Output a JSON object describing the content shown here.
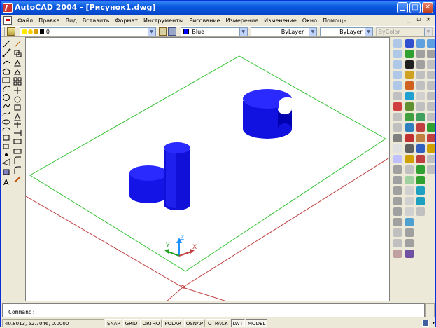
{
  "window": {
    "title": "AutoCAD 2004 - [Рисунок1.dwg]"
  },
  "menu": [
    "Файл",
    "Правка",
    "Вид",
    "Вставить",
    "Формат",
    "Инструменты",
    "Рисование",
    "Измерение",
    "Изменение",
    "Окно",
    "Помощь"
  ],
  "toolbar": {
    "layer": "0",
    "color": "Blue",
    "color_hex": "#0000ff",
    "linetype": "ByLayer",
    "lineweight": "ByLayer",
    "plotstyle": "ByColor"
  },
  "ucs": {
    "x": "X",
    "y": "Y",
    "z": "Z"
  },
  "command": {
    "prompt": "Command:"
  },
  "status": {
    "coords": "40.8013, 52.7046, 0.0000",
    "buttons": [
      "SNAP",
      "GRID",
      "ORTHO",
      "POLAR",
      "OSNAP",
      "OTRACK",
      "LWT",
      "MODEL"
    ]
  },
  "colors": {
    "grid_green": "#33c433",
    "axis_red": "#c04040",
    "solid_blue": "#1a1aff"
  }
}
